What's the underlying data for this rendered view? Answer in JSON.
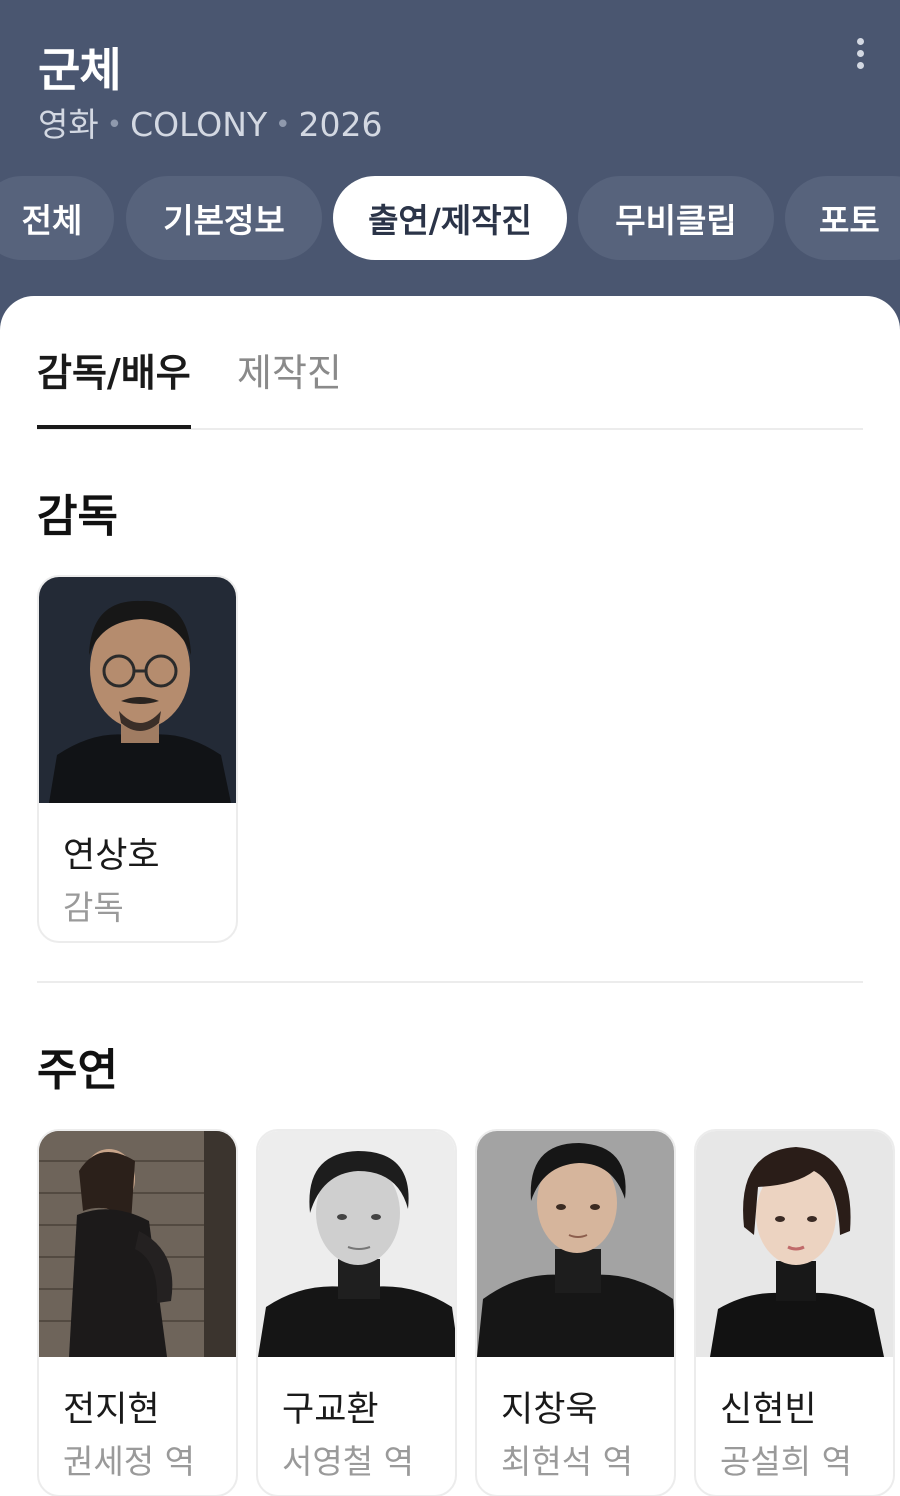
{
  "header": {
    "title": "군체",
    "meta": [
      "영화",
      "COLONY",
      "2026"
    ]
  },
  "tabs": [
    {
      "label": "전체",
      "active": false
    },
    {
      "label": "기본정보",
      "active": false
    },
    {
      "label": "출연/제작진",
      "active": true
    },
    {
      "label": "무비클립",
      "active": false
    },
    {
      "label": "포토",
      "active": false
    }
  ],
  "subtabs": [
    {
      "label": "감독/배우",
      "active": true
    },
    {
      "label": "제작진",
      "active": false
    }
  ],
  "sections": {
    "director": {
      "title": "감독",
      "people": [
        {
          "name": "연상호",
          "role": "감독"
        }
      ]
    },
    "lead": {
      "title": "주연",
      "people": [
        {
          "name": "전지현",
          "role": "권세정 역"
        },
        {
          "name": "구교환",
          "role": "서영철 역"
        },
        {
          "name": "지창욱",
          "role": "최현석 역"
        },
        {
          "name": "신현빈",
          "role": "공설희 역"
        }
      ]
    }
  },
  "icons": {
    "more": "more-vertical-icon"
  },
  "colors": {
    "header_bg": "#4a5670",
    "tab_bg": "#57637c",
    "tab_active_bg": "#ffffff",
    "sheet_bg": "#ffffff",
    "text_primary": "#1a1a1a",
    "text_secondary": "#9a9a9a"
  }
}
